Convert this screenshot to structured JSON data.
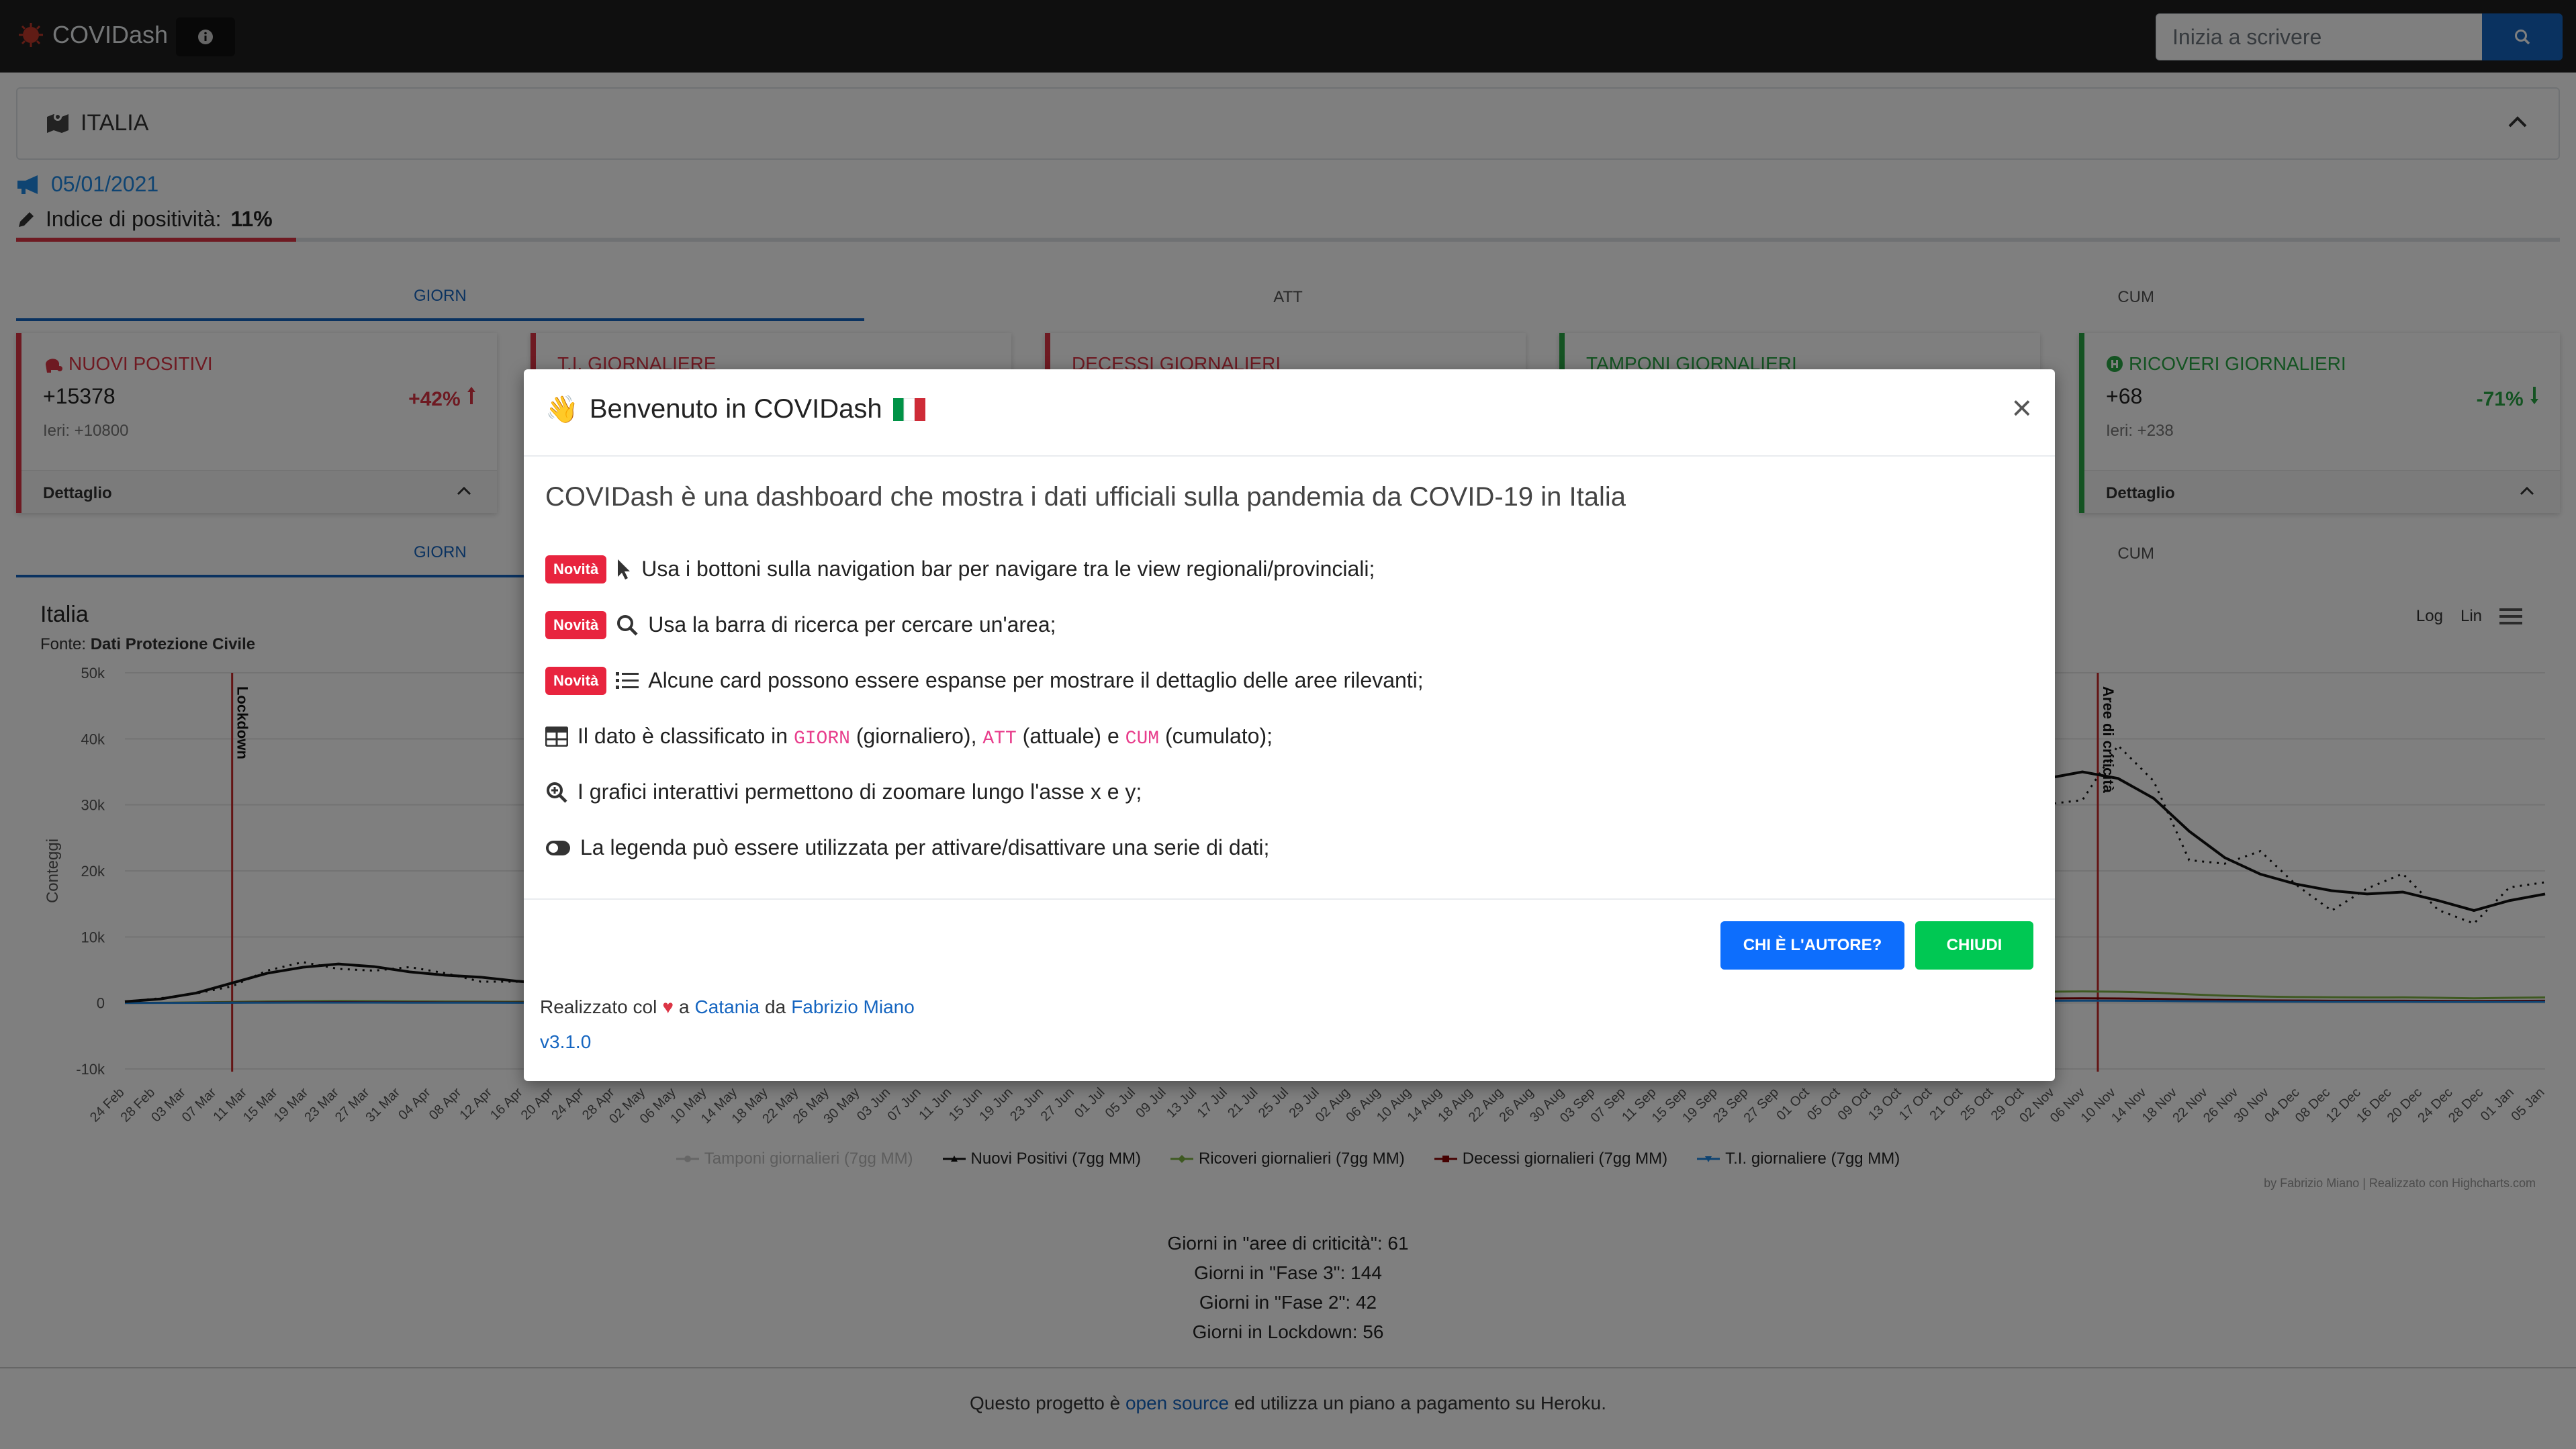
{
  "navbar": {
    "brand": "COVIDash",
    "search_placeholder": "Inizia a scrivere"
  },
  "region": {
    "name": "ITALIA"
  },
  "summary": {
    "date": "05/01/2021",
    "positivity_label": "Indice di positività:",
    "positivity_value": "11%",
    "positivity_fraction": 0.11
  },
  "tabs": [
    "GIORN",
    "ATT",
    "CUM"
  ],
  "active_tab": "GIORN",
  "cards": [
    {
      "title": "NUOVI POSITIVI",
      "value": "+15378",
      "pct": "+42%",
      "yesterday": "Ieri: +10800",
      "detail": "Dettaglio",
      "color": "#dc3545"
    },
    {
      "title": "T.I. GIORNALIERE",
      "color": "#dc3545"
    },
    {
      "title": "DECESSI GIORNALIERI",
      "color": "#dc3545"
    },
    {
      "title": "TAMPONI GIORNALIERI",
      "color": "#28a745"
    },
    {
      "title": "RICOVERI GIORNALIERI",
      "value": "+68",
      "pct": "-71%",
      "yesterday": "Ieri: +238",
      "detail": "Dettaglio",
      "color": "#28a745"
    }
  ],
  "chart": {
    "title": "Italia",
    "source_label": "Fonte:",
    "source_value": "Dati Protezione Civile",
    "log_label": "Log",
    "lin_label": "Lin",
    "credits": "by Fabrizio Miano | Realizzato con Highcharts.com"
  },
  "chart_data": {
    "type": "line",
    "ylabel": "Conteggi",
    "ylim": [
      -10000,
      50000
    ],
    "yticks": [
      "50k",
      "40k",
      "30k",
      "20k",
      "10k",
      "0",
      "-10k"
    ],
    "x_labels": [
      "24 Feb",
      "28 Feb",
      "03 Mar",
      "07 Mar",
      "11 Mar",
      "15 Mar",
      "19 Mar",
      "23 Mar",
      "27 Mar",
      "31 Mar",
      "04 Apr",
      "08 Apr",
      "12 Apr",
      "16 Apr",
      "20 Apr",
      "24 Apr",
      "28 Apr",
      "02 May",
      "06 May",
      "10 May",
      "14 May",
      "18 May",
      "22 May",
      "26 May",
      "30 May",
      "03 Jun",
      "07 Jun",
      "11 Jun",
      "15 Jun",
      "19 Jun",
      "23 Jun",
      "27 Jun",
      "01 Jul",
      "05 Jul",
      "09 Jul",
      "13 Jul",
      "17 Jul",
      "21 Jul",
      "25 Jul",
      "29 Jul",
      "02 Aug",
      "06 Aug",
      "10 Aug",
      "14 Aug",
      "18 Aug",
      "22 Aug",
      "26 Aug",
      "30 Aug",
      "03 Sep",
      "07 Sep",
      "11 Sep",
      "15 Sep",
      "19 Sep",
      "23 Sep",
      "27 Sep",
      "01 Oct",
      "05 Oct",
      "09 Oct",
      "13 Oct",
      "17 Oct",
      "21 Oct",
      "25 Oct",
      "29 Oct",
      "02 Nov",
      "06 Nov",
      "10 Nov",
      "14 Nov",
      "18 Nov",
      "22 Nov",
      "26 Nov",
      "30 Nov",
      "04 Dec",
      "08 Dec",
      "12 Dec",
      "16 Dec",
      "20 Dec",
      "24 Dec",
      "28 Dec",
      "01 Jan",
      "05 Jan"
    ],
    "plotlines": [
      {
        "label": "Lockdown",
        "x_index": 3.5
      },
      {
        "label": "Aree di criticità",
        "x_index": 64.4
      }
    ],
    "series": [
      {
        "name": "Tamponi giornalieri (7gg MM)",
        "color": "#cccccc",
        "muted": true,
        "values": []
      },
      {
        "name": "Nuovi Positivi (7gg MM)",
        "color": "#111111",
        "values": [
          200,
          600,
          1500,
          3000,
          4500,
          5400,
          5900,
          5500,
          4700,
          4200,
          3900,
          3300,
          2900,
          2500,
          2000,
          1500,
          1200,
          900,
          700,
          500,
          300,
          250,
          200,
          180,
          170,
          160,
          150,
          160,
          170,
          190,
          200,
          220,
          240,
          260,
          300,
          350,
          450,
          600,
          900,
          1200,
          1400,
          1500,
          1600,
          1700,
          1800,
          1900,
          2100,
          2500,
          3500,
          5000,
          8000,
          14000,
          22000,
          30000,
          34000,
          35000,
          34000,
          31000,
          26000,
          22000,
          19500,
          18000,
          17000,
          16500,
          16800,
          15500,
          14000,
          15500,
          16500
        ]
      }
    ],
    "visible_right_overlay_values": [
      30000,
      33000,
      35000,
      35000,
      34500,
      32000,
      28000,
      24000,
      21000,
      19000,
      17500,
      17000,
      16500,
      17000,
      16000,
      15000,
      14000,
      13500,
      15000,
      16500
    ]
  },
  "legend": [
    {
      "name": "Tamponi giornalieri (7gg MM)",
      "color": "#cccccc",
      "muted": true
    },
    {
      "name": "Nuovi Positivi (7gg MM)",
      "color": "#111111"
    },
    {
      "name": "Ricoveri giornalieri (7gg MM)",
      "color": "#7cb342"
    },
    {
      "name": "Decessi giornalieri (7gg MM)",
      "color": "#8b0000"
    },
    {
      "name": "T.I. giornaliere (7gg MM)",
      "color": "#1e88e5"
    }
  ],
  "stats": [
    "Giorni in \"aree di criticità\": 61",
    "Giorni in \"Fase 3\": 144",
    "Giorni in \"Fase 2\": 42",
    "Giorni in Lockdown: 56"
  ],
  "footer": {
    "prefix": "Questo progetto è ",
    "link": "open source",
    "suffix": " ed utilizza un piano a pagamento su Heroku."
  },
  "modal": {
    "title": "Benvenuto in COVIDash",
    "emoji_wave": "👋",
    "emoji_flag": "🇮🇹",
    "close": "×",
    "lead": "COVIDash è una dashboard che mostra i dati ufficiali sulla pandemia da COVID-19 in Italia",
    "badge": "Novità",
    "items": [
      {
        "icon": "pointer-icon",
        "text": "Usa i bottoni sulla navigation bar per navigare tra le view regionali/provinciali;",
        "badge": true
      },
      {
        "icon": "search-icon",
        "text": "Usa la barra di ricerca per cercare un'area;",
        "badge": true
      },
      {
        "icon": "list-icon",
        "text": "Alcune card possono essere espanse per mostrare il dettaglio delle aree rilevanti;",
        "badge": true
      },
      {
        "icon": "table-icon",
        "text_parts": [
          "Il dato è classificato in ",
          "GIORN",
          " (giornaliero), ",
          "ATT",
          " (attuale) e ",
          "CUM",
          " (cumulato);"
        ],
        "badge": false
      },
      {
        "icon": "zoom-in-icon",
        "text": "I grafici interattivi permettono di zoomare lungo l'asse x e y;",
        "badge": false
      },
      {
        "icon": "toggle-icon",
        "text": "La legenda può essere utilizzata per attivare/disattivare una serie di dati;",
        "badge": false
      }
    ],
    "btn_author": "CHI È L'AUTORE?",
    "btn_close": "CHIUDI",
    "made_prefix": "Realizzato col",
    "made_heart": "♥",
    "made_a": "a",
    "made_city": "Catania",
    "made_da": "da",
    "made_author": "Fabrizio Miano",
    "version": "v3.1.0"
  }
}
